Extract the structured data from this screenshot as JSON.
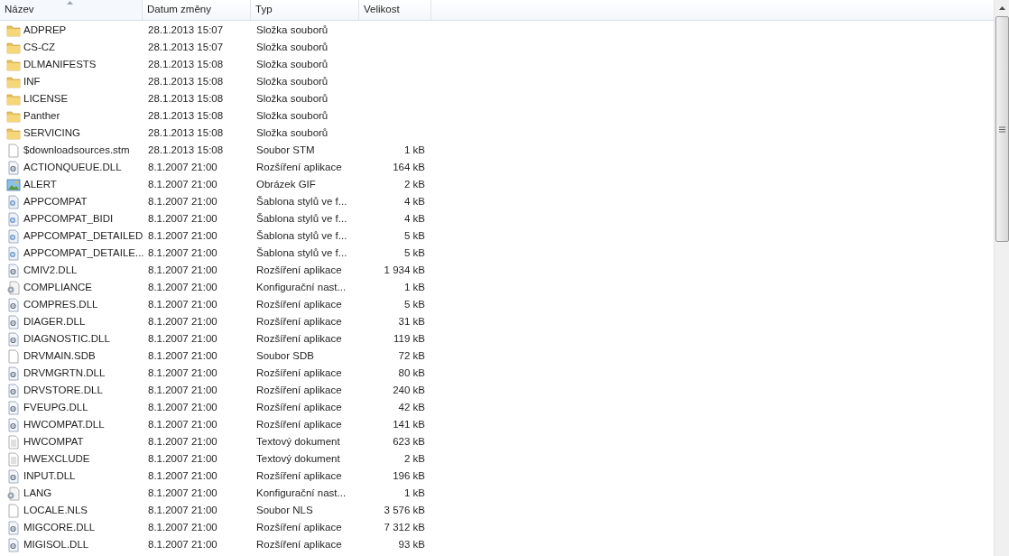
{
  "columns": [
    {
      "label": "Název",
      "sorted": true
    },
    {
      "label": "Datum změny",
      "sorted": false
    },
    {
      "label": "Typ",
      "sorted": false
    },
    {
      "label": "Velikost",
      "sorted": false
    }
  ],
  "rows": [
    {
      "kind": "folder",
      "name": "ADPREP",
      "date": "28.1.2013 15:07",
      "type": "Složka souborů",
      "size": ""
    },
    {
      "kind": "folder",
      "name": "CS-CZ",
      "date": "28.1.2013 15:07",
      "type": "Složka souborů",
      "size": ""
    },
    {
      "kind": "folder",
      "name": "DLMANIFESTS",
      "date": "28.1.2013 15:08",
      "type": "Složka souborů",
      "size": ""
    },
    {
      "kind": "folder",
      "name": "INF",
      "date": "28.1.2013 15:08",
      "type": "Složka souborů",
      "size": ""
    },
    {
      "kind": "folder",
      "name": "LICENSE",
      "date": "28.1.2013 15:08",
      "type": "Složka souborů",
      "size": ""
    },
    {
      "kind": "folder",
      "name": "Panther",
      "date": "28.1.2013 15:08",
      "type": "Složka souborů",
      "size": ""
    },
    {
      "kind": "folder",
      "name": "SERVICING",
      "date": "28.1.2013 15:08",
      "type": "Složka souborů",
      "size": ""
    },
    {
      "kind": "file",
      "name": "$downloadsources.stm",
      "date": "28.1.2013 15:08",
      "type": "Soubor STM",
      "size": "1 kB"
    },
    {
      "kind": "dll",
      "name": "ACTIONQUEUE.DLL",
      "date": "8.1.2007 21:00",
      "type": "Rozšíření aplikace",
      "size": "164 kB"
    },
    {
      "kind": "image",
      "name": "ALERT",
      "date": "8.1.2007 21:00",
      "type": "Obrázek GIF",
      "size": "2 kB"
    },
    {
      "kind": "style",
      "name": "APPCOMPAT",
      "date": "8.1.2007 21:00",
      "type": "Šablona stylů ve f...",
      "size": "4 kB"
    },
    {
      "kind": "style",
      "name": "APPCOMPAT_BIDI",
      "date": "8.1.2007 21:00",
      "type": "Šablona stylů ve f...",
      "size": "4 kB"
    },
    {
      "kind": "style",
      "name": "APPCOMPAT_DETAILED",
      "date": "8.1.2007 21:00",
      "type": "Šablona stylů ve f...",
      "size": "5 kB"
    },
    {
      "kind": "style",
      "name": "APPCOMPAT_DETAILE...",
      "date": "8.1.2007 21:00",
      "type": "Šablona stylů ve f...",
      "size": "5 kB"
    },
    {
      "kind": "dll",
      "name": "CMIV2.DLL",
      "date": "8.1.2007 21:00",
      "type": "Rozšíření aplikace",
      "size": "1 934 kB"
    },
    {
      "kind": "config",
      "name": "COMPLIANCE",
      "date": "8.1.2007 21:00",
      "type": "Konfigurační nast...",
      "size": "1 kB"
    },
    {
      "kind": "dll",
      "name": "COMPRES.DLL",
      "date": "8.1.2007 21:00",
      "type": "Rozšíření aplikace",
      "size": "5 kB"
    },
    {
      "kind": "dll",
      "name": "DIAGER.DLL",
      "date": "8.1.2007 21:00",
      "type": "Rozšíření aplikace",
      "size": "31 kB"
    },
    {
      "kind": "dll",
      "name": "DIAGNOSTIC.DLL",
      "date": "8.1.2007 21:00",
      "type": "Rozšíření aplikace",
      "size": "119 kB"
    },
    {
      "kind": "file",
      "name": "DRVMAIN.SDB",
      "date": "8.1.2007 21:00",
      "type": "Soubor SDB",
      "size": "72 kB"
    },
    {
      "kind": "dll",
      "name": "DRVMGRTN.DLL",
      "date": "8.1.2007 21:00",
      "type": "Rozšíření aplikace",
      "size": "80 kB"
    },
    {
      "kind": "dll",
      "name": "DRVSTORE.DLL",
      "date": "8.1.2007 21:00",
      "type": "Rozšíření aplikace",
      "size": "240 kB"
    },
    {
      "kind": "dll",
      "name": "FVEUPG.DLL",
      "date": "8.1.2007 21:00",
      "type": "Rozšíření aplikace",
      "size": "42 kB"
    },
    {
      "kind": "dll",
      "name": "HWCOMPAT.DLL",
      "date": "8.1.2007 21:00",
      "type": "Rozšíření aplikace",
      "size": "141 kB"
    },
    {
      "kind": "text",
      "name": "HWCOMPAT",
      "date": "8.1.2007 21:00",
      "type": "Textový dokument",
      "size": "623 kB"
    },
    {
      "kind": "text",
      "name": "HWEXCLUDE",
      "date": "8.1.2007 21:00",
      "type": "Textový dokument",
      "size": "2 kB"
    },
    {
      "kind": "dll",
      "name": "INPUT.DLL",
      "date": "8.1.2007 21:00",
      "type": "Rozšíření aplikace",
      "size": "196 kB"
    },
    {
      "kind": "config",
      "name": "LANG",
      "date": "8.1.2007 21:00",
      "type": "Konfigurační nast...",
      "size": "1 kB"
    },
    {
      "kind": "file",
      "name": "LOCALE.NLS",
      "date": "8.1.2007 21:00",
      "type": "Soubor NLS",
      "size": "3 576 kB"
    },
    {
      "kind": "dll",
      "name": "MIGCORE.DLL",
      "date": "8.1.2007 21:00",
      "type": "Rozšíření aplikace",
      "size": "7 312 kB"
    },
    {
      "kind": "dll",
      "name": "MIGISOL.DLL",
      "date": "8.1.2007 21:00",
      "type": "Rozšíření aplikace",
      "size": "93 kB"
    }
  ]
}
